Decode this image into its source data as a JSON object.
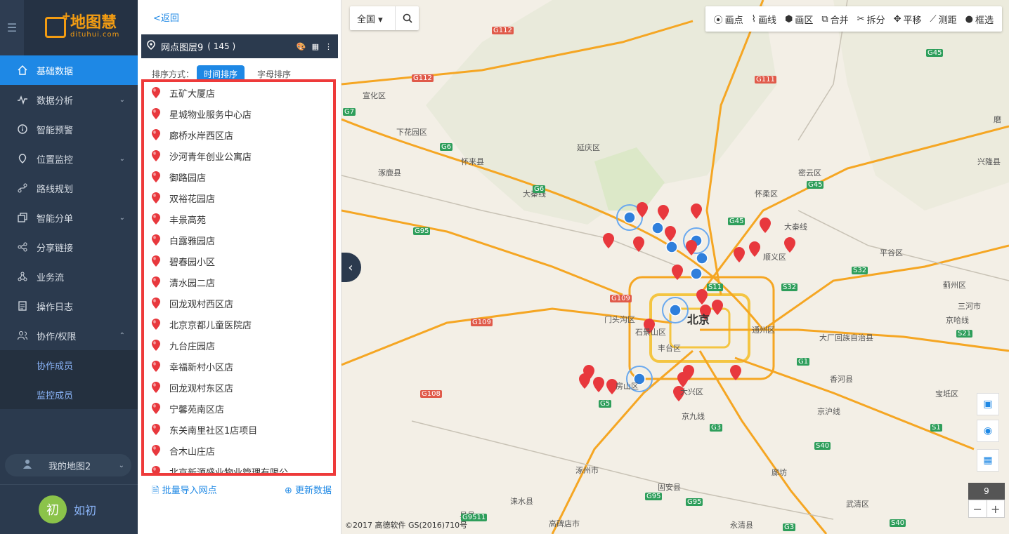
{
  "sidebar": {
    "logo": {
      "title": "地图慧",
      "sub": "dituhui.com"
    },
    "menu": [
      {
        "label": "基础数据",
        "icon": "home-icon",
        "active": true
      },
      {
        "label": "数据分析",
        "icon": "analytics-icon"
      },
      {
        "label": "智能预警",
        "icon": "info-icon"
      },
      {
        "label": "位置监控",
        "icon": "location-icon"
      },
      {
        "label": "路线规划",
        "icon": "route-icon"
      },
      {
        "label": "智能分单",
        "icon": "copy-icon"
      },
      {
        "label": "分享链接",
        "icon": "share-icon"
      },
      {
        "label": "业务流",
        "icon": "workflow-icon"
      },
      {
        "label": "操作日志",
        "icon": "log-icon"
      },
      {
        "label": "协作/权限",
        "icon": "users-icon"
      }
    ],
    "submenu": [
      "协作成员",
      "监控成员"
    ],
    "mymap": "我的地图2",
    "user": {
      "avatar": "初",
      "name": "如初"
    }
  },
  "panel": {
    "back": "<返回",
    "layer": {
      "name": "网点图层9",
      "count": "( 145 )"
    },
    "sort": {
      "label": "排序方式：",
      "time": "时间排序",
      "alpha": "字母排序"
    },
    "items": [
      "五矿大厦店",
      "星城物业服务中心店",
      "廊桥水岸西区店",
      "沙河青年创业公寓店",
      "御路园店",
      "双裕花园店",
      "丰景高苑",
      "白露雅园店",
      "碧春园小区",
      "清水园二店",
      "回龙观村西区店",
      "北京京都儿童医院店",
      "九台庄园店",
      "幸福新村小区店",
      "回龙观村东区店",
      "宁馨苑南区店",
      "东关南里社区1店项目",
      "合木山庄店",
      "北京新源盛业物业管理有限公"
    ],
    "import": "批量导入网点",
    "refresh": "更新数据"
  },
  "map": {
    "region": "全国",
    "tools": [
      "画点",
      "画线",
      "画区",
      "合并",
      "拆分",
      "平移",
      "测距",
      "框选"
    ],
    "zoom": "9",
    "copyright": "©2017 高德软件 GS(2016)710号",
    "city": "北京",
    "labels": [
      {
        "t": "宣化区"
      },
      {
        "t": "下花园区"
      },
      {
        "t": "怀来县"
      },
      {
        "t": "涿鹿县"
      },
      {
        "t": "延庆区"
      },
      {
        "t": "密云区"
      },
      {
        "t": "怀柔区"
      },
      {
        "t": "兴隆县"
      },
      {
        "t": "平谷区"
      },
      {
        "t": "顺义区"
      },
      {
        "t": "蓟州区"
      },
      {
        "t": "三河市"
      },
      {
        "t": "大厂回族自治县"
      },
      {
        "t": "通州区"
      },
      {
        "t": "香河县"
      },
      {
        "t": "宝坻区"
      },
      {
        "t": "门头沟区"
      },
      {
        "t": "石景山区"
      },
      {
        "t": "丰台区"
      },
      {
        "t": "房山区"
      },
      {
        "t": "大兴区"
      },
      {
        "t": "涿州市"
      },
      {
        "t": "固安县"
      },
      {
        "t": "廊坊"
      },
      {
        "t": "涞水县"
      },
      {
        "t": "高碑店市"
      },
      {
        "t": "永清县"
      },
      {
        "t": "武清区"
      },
      {
        "t": "易县"
      },
      {
        "t": "大秦线"
      },
      {
        "t": "京哈线"
      },
      {
        "t": "京九线"
      },
      {
        "t": "京沪线"
      },
      {
        "t": "大秦线"
      },
      {
        "t": "磨"
      }
    ],
    "highways": [
      "G112",
      "G112",
      "G111",
      "G7",
      "G6",
      "G6",
      "G95",
      "G45",
      "G45",
      "G45",
      "S32",
      "S32",
      "S11",
      "G109",
      "G109",
      "G1",
      "S21",
      "G108",
      "G5",
      "G3",
      "S1",
      "S40",
      "G95",
      "G9511",
      "G95",
      "G3",
      "S40"
    ]
  },
  "colors": {
    "accent": "#1e88e5",
    "sidebar": "#2b3a4e",
    "highlight": "#ee3a3a",
    "pin": "#e8383d"
  }
}
